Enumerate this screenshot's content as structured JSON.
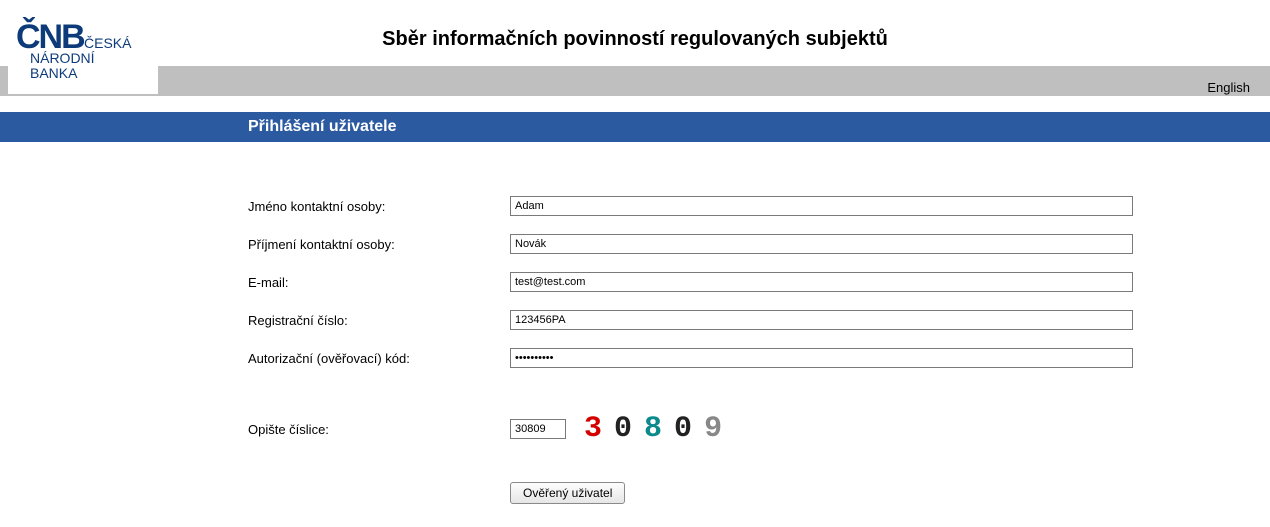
{
  "header": {
    "title": "Sběr informačních povinností regulovaných subjektů",
    "lang_link": "English",
    "section_title": "Přihlášení uživatele"
  },
  "logo": {
    "line1a": "Č",
    "line1b": "ESKÁ",
    "line2": "NÁRODNÍ",
    "line3": "BANKA"
  },
  "form": {
    "first_name_label": "Jméno kontaktní osoby:",
    "first_name_value": "Adam",
    "last_name_label": "Příjmení kontaktní osoby:",
    "last_name_value": "Novák",
    "email_label": "E-mail:",
    "email_value": "test@test.com",
    "reg_label": "Registrační číslo:",
    "reg_value": "123456PA",
    "auth_label": "Autorizační (ověřovací) kód:",
    "auth_value": "••••••••••",
    "captcha_label": "Opište číslice:",
    "captcha_input_value": "30809",
    "captcha_digits": [
      {
        "d": "3",
        "c": "#d40000"
      },
      {
        "d": "0",
        "c": "#222222"
      },
      {
        "d": "8",
        "c": "#0a8a8a"
      },
      {
        "d": "0",
        "c": "#222222"
      },
      {
        "d": "9",
        "c": "#888888"
      }
    ],
    "submit_label": "Ověřený uživatel"
  }
}
